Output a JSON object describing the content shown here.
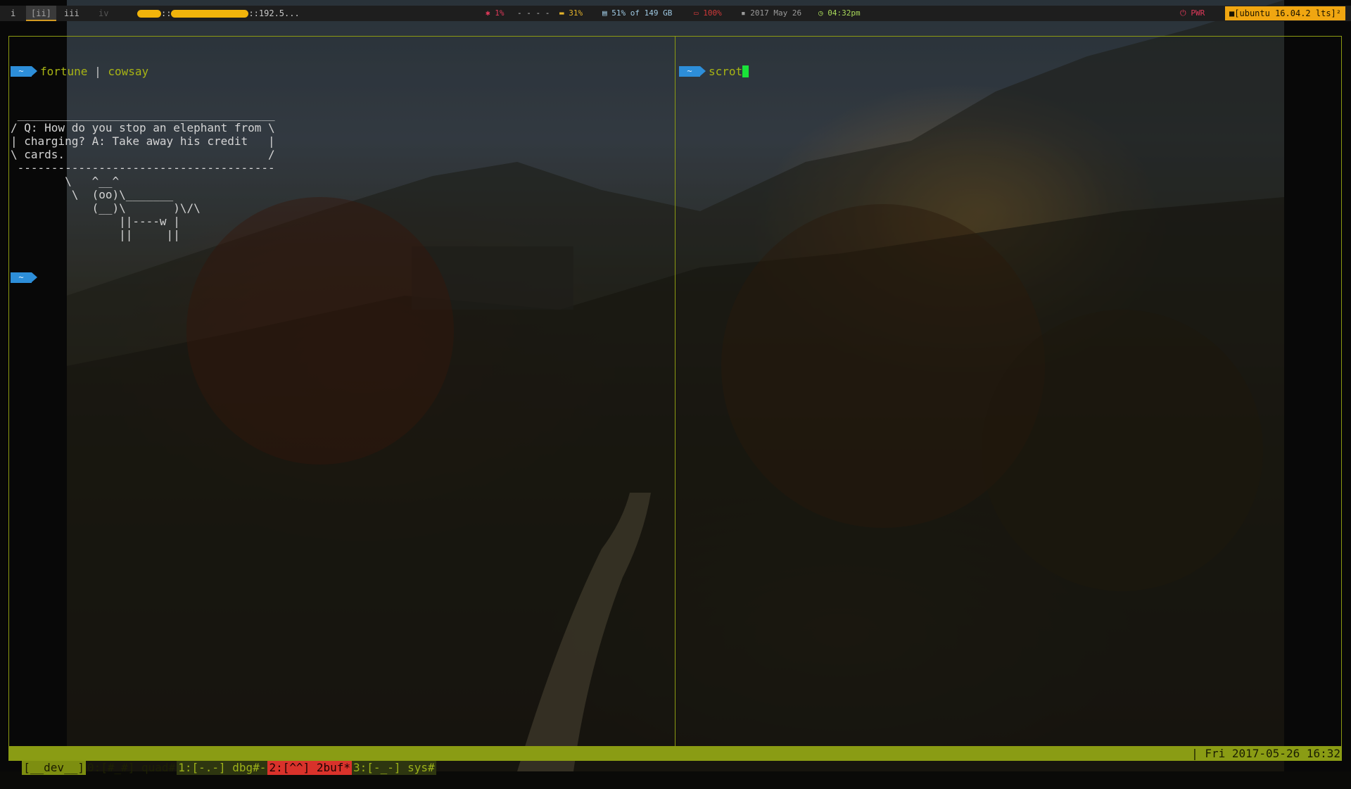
{
  "topbar": {
    "workspaces": [
      {
        "label": "i",
        "state": "normal"
      },
      {
        "label": "[ii]",
        "state": "active"
      },
      {
        "label": "iii",
        "state": "normal"
      },
      {
        "label": "iv",
        "state": "dim"
      }
    ],
    "host_suffix": "::192.5...",
    "cpu": "1%",
    "net": "- - - -",
    "mem": "31%",
    "disk": "51% of 149 GB",
    "battery": "100%",
    "date": "2017 May 26",
    "time": "04:32pm",
    "power": "PWR",
    "os_badge": "[ubuntu 16.04.2 lts]²",
    "colors": {
      "cpu": "#e0395a",
      "mem": "#e3b22a",
      "disk": "#9fc9e3",
      "battery": "#d23939",
      "time": "#a8d85a",
      "power": "#e0395a",
      "badge": "#f0a611"
    }
  },
  "left_pane": {
    "prompt_symbol": "~",
    "command": "fortune",
    "pipe": "|",
    "command2": "cowsay",
    "cow_output": " ______________________________________\n/ Q: How do you stop an elephant from \\\n| charging? A: Take away his credit   |\n\\ cards.                              /\n --------------------------------------\n        \\   ^__^\n         \\  (oo)\\_______\n            (__)\\       )\\/\\\n                ||----w |\n                ||     ||",
    "prompt2_symbol": "~"
  },
  "right_pane": {
    "prompt_symbol": "~",
    "command": "scrot"
  },
  "statusbar": {
    "session": "[__dev__]",
    "windows": [
      {
        "label": "0:[#_#] quad#",
        "state": "normal"
      },
      {
        "label": "1:[-.-] dbg#-",
        "state": "dark"
      },
      {
        "label": "2:[^^] 2buf*",
        "state": "current"
      },
      {
        "label": "3:[-_-] sys#",
        "state": "dark"
      }
    ],
    "right": "| Fri 2017-05-26 16:32"
  }
}
